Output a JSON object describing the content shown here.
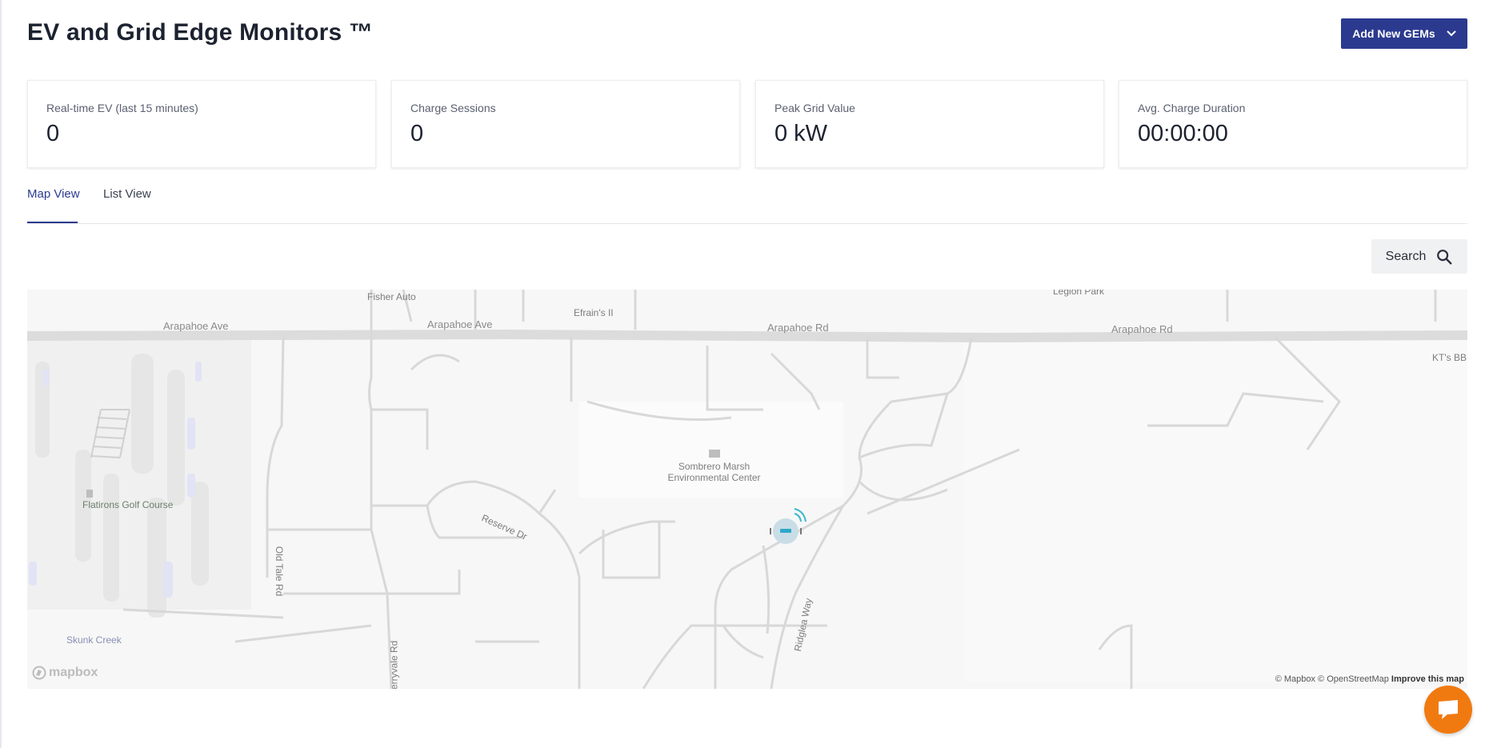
{
  "header": {
    "title": "EV and Grid Edge Monitors ™",
    "add_button_label": "Add New GEMs"
  },
  "stats": [
    {
      "label": "Real-time EV (last 15 minutes)",
      "value": "0"
    },
    {
      "label": "Charge Sessions",
      "value": "0"
    },
    {
      "label": "Peak Grid Value",
      "value": "0 kW"
    },
    {
      "label": "Avg. Charge Duration",
      "value": "00:00:00"
    }
  ],
  "tabs": [
    {
      "label": "Map View",
      "active": true
    },
    {
      "label": "List View",
      "active": false
    }
  ],
  "search": {
    "label": "Search"
  },
  "map": {
    "labels": {
      "road1": "Arapahoe Ave",
      "road2": "Arapahoe Ave",
      "road3": "Arapahoe Rd",
      "road4": "Arapahoe Rd",
      "fisher": "Fisher Auto",
      "efrains": "Efrain's II",
      "legion": "Legion Park",
      "kts": "KT's BB",
      "marsh_line1": "Sombrero Marsh",
      "marsh_line2": "Environmental Center",
      "golf": "Flatirons Golf Course",
      "reserve": "Reserve Dr",
      "old_tale": "Old Tale Rd",
      "ridglea": "Ridglea Way",
      "skunk": "Skunk Creek",
      "cherryvale": "Cherryvale Rd"
    },
    "logo": "mapbox",
    "attribution": "© Mapbox © OpenStreetMap",
    "improve_link": "Improve this map"
  },
  "colors": {
    "primary": "#2b3a8f",
    "chat": "#f07a10",
    "marker": "#3bb7d0"
  },
  "icons": {
    "dropdown": "chevron-down-icon",
    "search": "search-icon",
    "marker": "ev-charger-marker-icon",
    "chat": "chat-icon"
  }
}
